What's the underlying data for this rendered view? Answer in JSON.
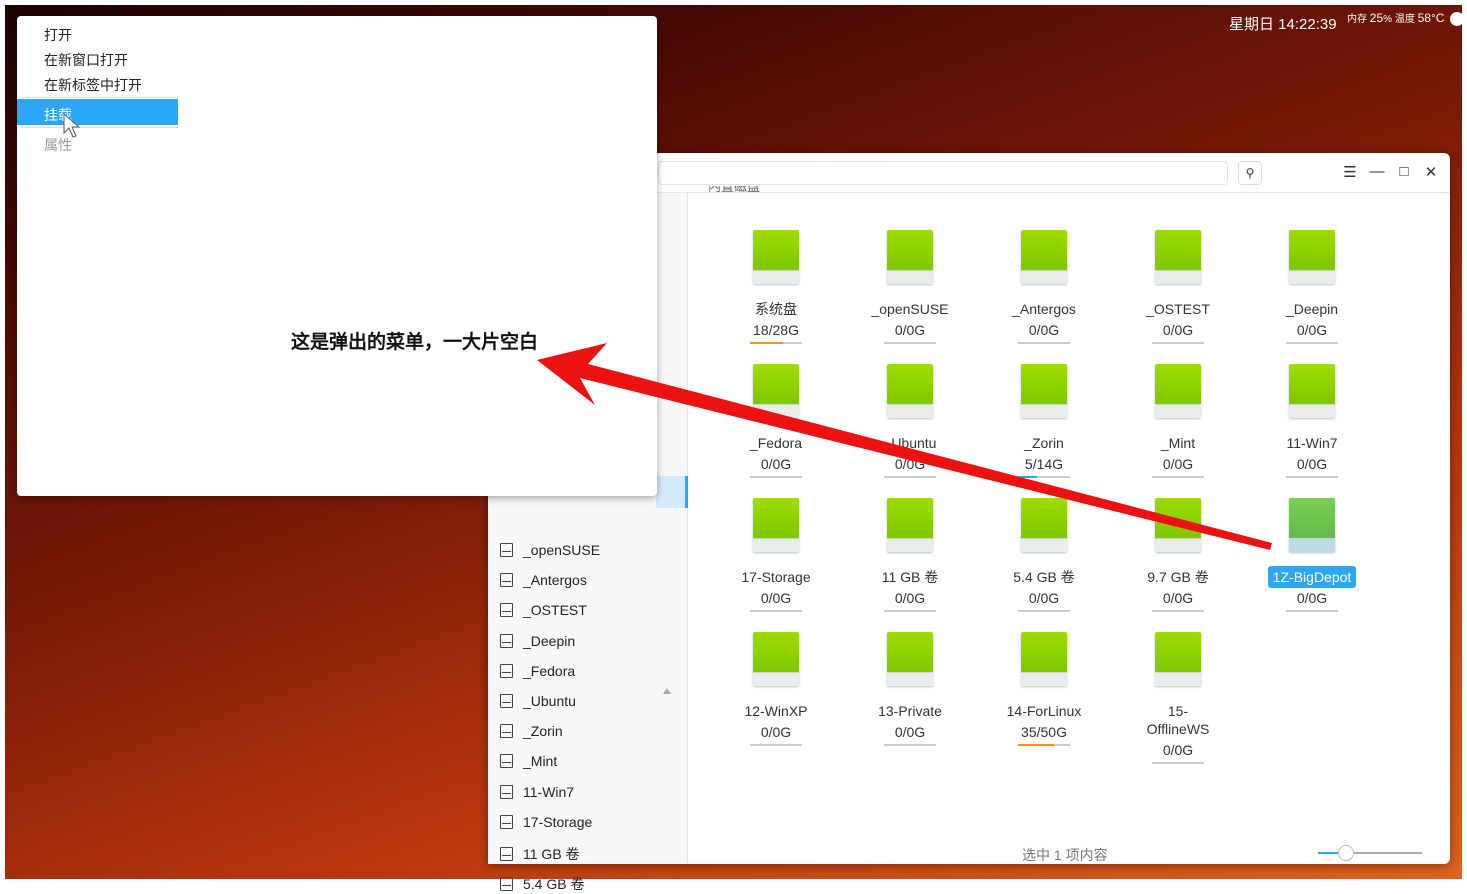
{
  "topbar": {
    "clock": "星期日 14:22:39",
    "mem_label": "内存",
    "mem_value": "25",
    "mem_unit": "%",
    "temp_label": "温度",
    "temp_value": "58°C"
  },
  "window": {
    "search_icon": "search-icon",
    "menu_icon": "☰",
    "min_icon": "—",
    "max_icon": "□",
    "close_icon": "✕",
    "section_title": "内置磁盘"
  },
  "sidebar": {
    "items": [
      "_openSUSE",
      "_Antergos",
      "_OSTEST",
      "_Deepin",
      "_Fedora",
      "_Ubuntu",
      "_Zorin",
      "_Mint",
      "11-Win7",
      "17-Storage",
      "11 GB 卷",
      "5.4 GB 卷"
    ]
  },
  "drives": [
    {
      "name": "系统盘",
      "size": "18/28G",
      "usage": 0.64,
      "color": "#f59222"
    },
    {
      "name": "_openSUSE",
      "size": "0/0G",
      "usage": 0
    },
    {
      "name": "_Antergos",
      "size": "0/0G",
      "usage": 0
    },
    {
      "name": "_OSTEST",
      "size": "0/0G",
      "usage": 0
    },
    {
      "name": "_Deepin",
      "size": "0/0G",
      "usage": 0
    },
    {
      "name": "_Fedora",
      "size": "0/0G",
      "usage": 0
    },
    {
      "name": "_Ubuntu",
      "size": "0/0G",
      "usage": 0
    },
    {
      "name": "_Zorin",
      "size": "5/14G",
      "usage": 0.36,
      "color": "#2ca7f8"
    },
    {
      "name": "_Mint",
      "size": "0/0G",
      "usage": 0
    },
    {
      "name": "11-Win7",
      "size": "0/0G",
      "usage": 0
    },
    {
      "name": "17-Storage",
      "size": "0/0G",
      "usage": 0
    },
    {
      "name": "11 GB 卷",
      "size": "0/0G",
      "usage": 0
    },
    {
      "name": "5.4 GB 卷",
      "size": "0/0G",
      "usage": 0
    },
    {
      "name": "9.7 GB 卷",
      "size": "0/0G",
      "usage": 0
    },
    {
      "name": "1Z-BigDepot",
      "size": "0/0G",
      "usage": 0,
      "selected": true
    },
    {
      "name": "12-WinXP",
      "size": "0/0G",
      "usage": 0
    },
    {
      "name": "13-Private",
      "size": "0/0G",
      "usage": 0
    },
    {
      "name": "14-ForLinux",
      "size": "35/50G",
      "usage": 0.7,
      "color": "#f59222"
    },
    {
      "name": "15-OfflineWS",
      "size": "0/0G",
      "usage": 0
    }
  ],
  "status": {
    "text": "选中 1 项内容",
    "zoom_level": 0.25
  },
  "context_menu": {
    "items": [
      "打开",
      "在新窗口打开",
      "在新标签中打开",
      "挂载",
      "属性"
    ],
    "highlighted": "挂载",
    "disabled": "属性"
  },
  "annotation": {
    "text": "这是弹出的菜单，一大片空白",
    "arrow_color": "#ee1111"
  }
}
